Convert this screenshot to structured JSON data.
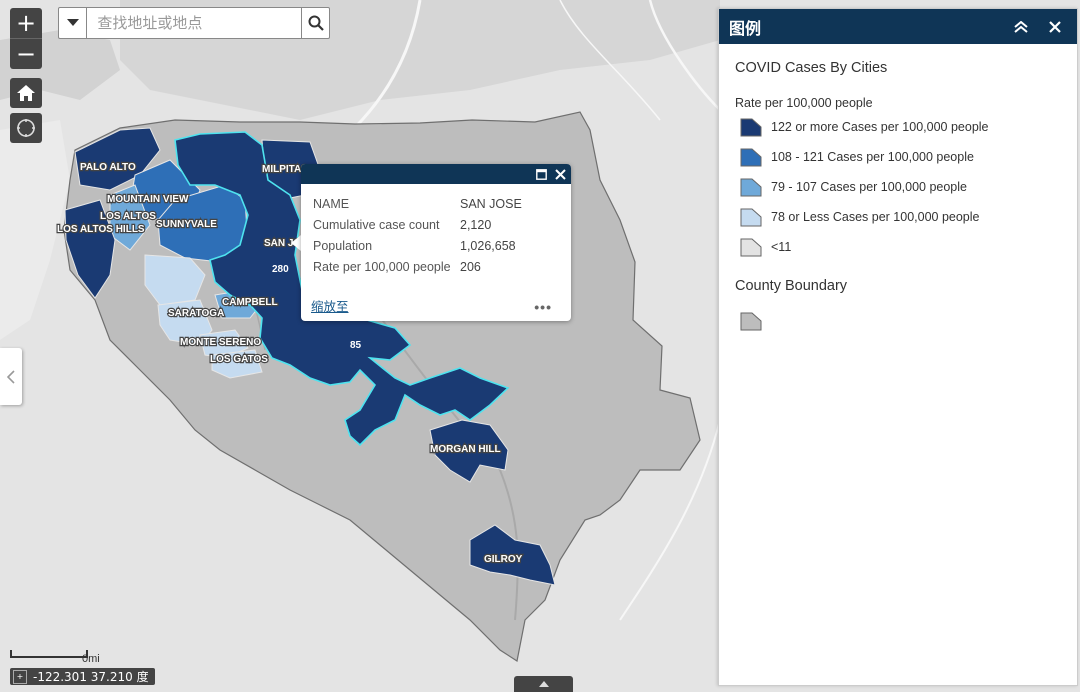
{
  "search": {
    "placeholder": "查找地址或地点"
  },
  "map_labels": {
    "cities": [
      "PALO ALTO",
      "MILPITAS",
      "MOUNTAIN VIEW",
      "LOS ALTOS",
      "SUNNYVALE",
      "LOS ALTOS HILLS",
      "SAN JOSE",
      "CAMPBELL",
      "SARATOGA",
      "MONTE SERENO",
      "LOS GATOS",
      "MORGAN HILL",
      "GILROY"
    ],
    "roads": [
      "280",
      "85"
    ]
  },
  "popup": {
    "fields": [
      {
        "key": "NAME",
        "value": "SAN JOSE"
      },
      {
        "key": "Cumulative case count",
        "value": "2,120"
      },
      {
        "key": "Population",
        "value": "1,026,658"
      },
      {
        "key": "Rate per 100,000 people",
        "value": "206"
      }
    ],
    "zoom_label": "缩放至",
    "more_label": "•••"
  },
  "legend": {
    "title": "图例",
    "layer_title": "COVID Cases By Cities",
    "subtitle": "Rate per 100,000 people",
    "classes": [
      {
        "label": "122 or more Cases per 100,000 people",
        "color": "#1a3a73"
      },
      {
        "label": "108 - 121 Cases per 100,000 people",
        "color": "#2e6fb7"
      },
      {
        "label": "79 - 107 Cases per 100,000 people",
        "color": "#6fa9d9"
      },
      {
        "label": "78 or Less Cases per 100,000 people",
        "color": "#c5dbf0"
      },
      {
        "label": "<11",
        "color": "#e3e3e3"
      }
    ],
    "boundary_title": "County Boundary",
    "boundary_color": "#bdbdbd"
  },
  "scale": {
    "label": "0mi"
  },
  "coordinates": {
    "text": "-122.301 37.210 度"
  },
  "colors": {
    "header": "#0f3556",
    "highlight": "#4ee3ef",
    "county": "#bdbdbd",
    "basemap": "#e5e5e5"
  }
}
